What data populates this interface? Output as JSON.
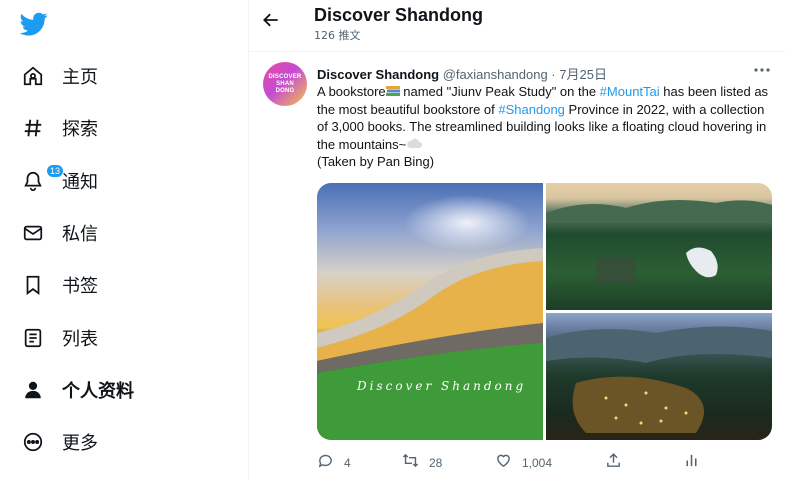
{
  "sidebar": {
    "logo_icon": "twitter-bird-icon",
    "brand_color": "#1d9bf0",
    "items": [
      {
        "label": "主页",
        "icon": "home-icon"
      },
      {
        "label": "探索",
        "icon": "hashtag-icon"
      },
      {
        "label": "通知",
        "icon": "bell-icon",
        "badge": "13"
      },
      {
        "label": "私信",
        "icon": "envelope-icon"
      },
      {
        "label": "书签",
        "icon": "bookmark-icon"
      },
      {
        "label": "列表",
        "icon": "list-icon"
      },
      {
        "label": "个人资料",
        "icon": "person-icon"
      },
      {
        "label": "更多",
        "icon": "more-circle-icon"
      }
    ]
  },
  "header": {
    "title": "Discover Shandong",
    "subtitle": "126 推文"
  },
  "tweet": {
    "avatar_text": [
      "DISCOVER",
      "SHAN",
      "DONG"
    ],
    "author_name": "Discover Shandong",
    "author_meta": "@faxianshandong · 7月25日",
    "text": {
      "p1": "A bookstore",
      "p2": " named \"Jiunv Peak Study\" on the ",
      "tag1": "#MountTai",
      "p3": " has been listed as the most beautiful bookstore of ",
      "tag2": "#Shandong",
      "p4": " Province in 2022, with a collection of 3,000 books. The streamlined building looks like a floating cloud hovering in the mountains~",
      "p5": "(Taken by Pan Bing)"
    },
    "watermark": "Discover  Shandong",
    "actions": {
      "replies": "4",
      "retweets": "28",
      "likes": "1,004"
    }
  }
}
